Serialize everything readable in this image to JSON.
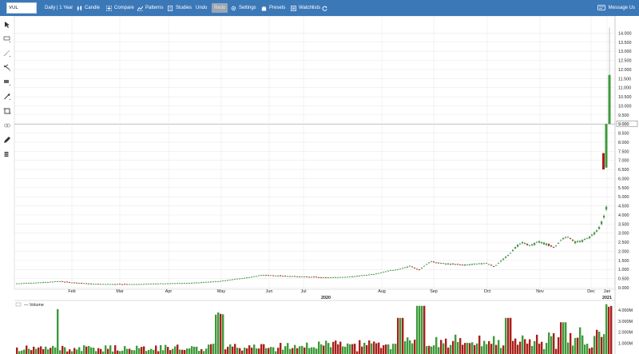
{
  "toolbar": {
    "symbol": "VUL",
    "periodicity": "Daily | 1 Year",
    "candle": "Candle",
    "compare": "Compare",
    "patterns": "Patterns",
    "studies": "Studies",
    "undo": "Undo",
    "redo": "Redo",
    "settings": "Settings",
    "presets": "Presets",
    "watchlists": "Watchlists",
    "message": "Message Us"
  },
  "colors": {
    "toolbar": "#3b78b8",
    "up": "#3e9a3a",
    "down": "#a8201a",
    "grid": "#e6e6e6"
  },
  "chart_data": {
    "type": "candlestick",
    "x_labels": [
      "Feb",
      "Mar",
      "Apr",
      "May",
      "Jun",
      "Jul",
      "2020",
      "Aug",
      "Sep",
      "Oct",
      "Nov",
      "Dec",
      "Jan",
      "2021"
    ],
    "y_ticks": [
      "14.000",
      "13.500",
      "13.000",
      "12.500",
      "12.000",
      "11.500",
      "11.000",
      "10.500",
      "10.000",
      "9.500",
      "9.000",
      "8.500",
      "8.000",
      "7.500",
      "7.000",
      "6.500",
      "6.000",
      "5.500",
      "5.000",
      "4.500",
      "4.000",
      "3.500",
      "3.000",
      "2.500",
      "2.000",
      "1.500",
      "1.000",
      "0.500",
      "0.000"
    ],
    "ylim": [
      0,
      14.5
    ],
    "last_price": "9.000",
    "price_path": [
      [
        0,
        0.22
      ],
      [
        40,
        0.3
      ],
      [
        55,
        0.35
      ],
      [
        70,
        0.28
      ],
      [
        100,
        0.2
      ],
      [
        140,
        0.18
      ],
      [
        180,
        0.22
      ],
      [
        220,
        0.25
      ],
      [
        255,
        0.35
      ],
      [
        290,
        0.55
      ],
      [
        310,
        0.7
      ],
      [
        330,
        0.65
      ],
      [
        360,
        0.6
      ],
      [
        390,
        0.55
      ],
      [
        420,
        0.6
      ],
      [
        450,
        0.75
      ],
      [
        470,
        0.95
      ],
      [
        480,
        1.0
      ],
      [
        495,
        1.2
      ],
      [
        505,
        0.95
      ],
      [
        520,
        1.45
      ],
      [
        530,
        1.35
      ],
      [
        545,
        1.3
      ],
      [
        560,
        1.25
      ],
      [
        575,
        1.3
      ],
      [
        590,
        1.35
      ],
      [
        600,
        1.15
      ],
      [
        610,
        1.55
      ],
      [
        620,
        1.9
      ],
      [
        628,
        2.3
      ],
      [
        635,
        2.5
      ],
      [
        645,
        2.3
      ],
      [
        655,
        2.55
      ],
      [
        665,
        2.4
      ],
      [
        675,
        2.2
      ],
      [
        685,
        2.7
      ],
      [
        693,
        2.8
      ],
      [
        700,
        2.5
      ],
      [
        710,
        2.6
      ],
      [
        720,
        2.8
      ],
      [
        730,
        3.2
      ],
      [
        738,
        4.0
      ],
      [
        742,
        4.8
      ],
      [
        747,
        6.8
      ],
      [
        750,
        7.3
      ],
      [
        756,
        11.0
      ]
    ],
    "volume": {
      "label": "Volume",
      "ticks": [
        "4.000M",
        "3.000M",
        "2.000M",
        "1.000M"
      ],
      "ylim": [
        0,
        4.6
      ]
    }
  }
}
